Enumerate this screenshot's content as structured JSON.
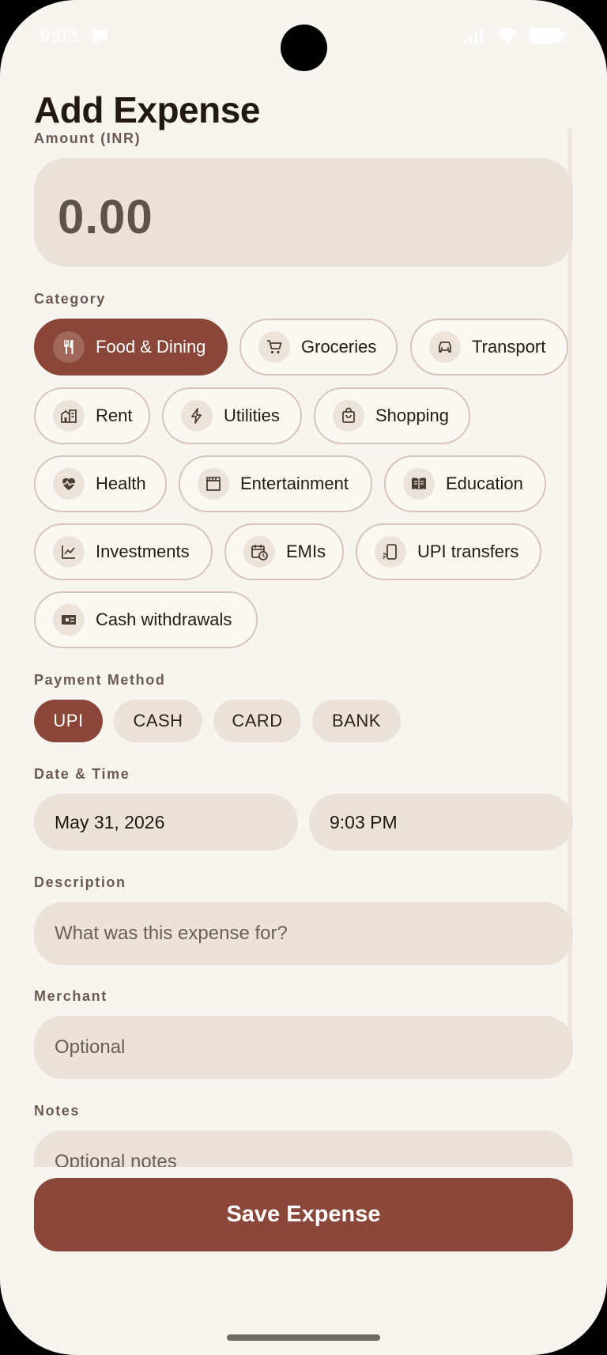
{
  "status_bar": {
    "time": "9:03"
  },
  "title": "Add Expense",
  "amount": {
    "label": "Amount (INR)",
    "value": "0.00"
  },
  "category": {
    "label": "Category",
    "selected": "Food & Dining",
    "items": [
      {
        "label": "Food & Dining",
        "icon": "fork-knife-icon"
      },
      {
        "label": "Groceries",
        "icon": "cart-icon"
      },
      {
        "label": "Transport",
        "icon": "car-icon"
      },
      {
        "label": "Rent",
        "icon": "building-icon"
      },
      {
        "label": "Utilities",
        "icon": "bolt-icon"
      },
      {
        "label": "Shopping",
        "icon": "shopping-bag-icon"
      },
      {
        "label": "Health",
        "icon": "heart-pulse-icon"
      },
      {
        "label": "Entertainment",
        "icon": "clapperboard-icon"
      },
      {
        "label": "Education",
        "icon": "book-icon"
      },
      {
        "label": "Investments",
        "icon": "chart-line-icon"
      },
      {
        "label": "EMIs",
        "icon": "calendar-clock-icon"
      },
      {
        "label": "UPI transfers",
        "icon": "phone-cast-icon"
      },
      {
        "label": "Cash withdrawals",
        "icon": "cash-icon"
      }
    ]
  },
  "payment_method": {
    "label": "Payment Method",
    "selected": "UPI",
    "options": [
      "UPI",
      "CASH",
      "CARD",
      "BANK"
    ]
  },
  "date_time": {
    "label": "Date & Time",
    "date": "May 31, 2026",
    "time": "9:03 PM"
  },
  "description": {
    "label": "Description",
    "placeholder": "What was this expense for?"
  },
  "merchant": {
    "label": "Merchant",
    "placeholder": "Optional"
  },
  "notes": {
    "label": "Notes",
    "placeholder": "Optional notes"
  },
  "save_button": "Save Expense",
  "colors": {
    "accent": "#8a4739",
    "background": "#f8f4ef",
    "field": "#ebe3d9",
    "chip_border": "#d9c4bd"
  }
}
